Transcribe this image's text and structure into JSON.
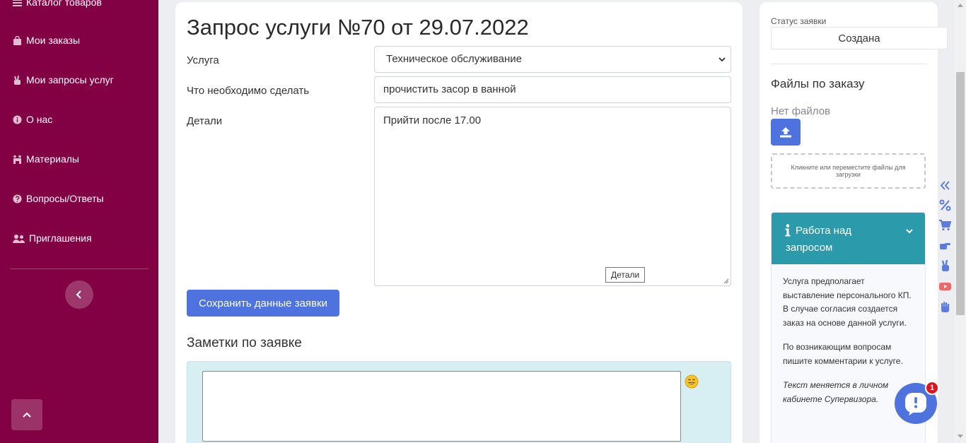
{
  "sidebar": {
    "items": [
      {
        "label": "Каталог товаров",
        "icon": "list-icon"
      },
      {
        "label": "Мои заказы",
        "icon": "shopping-bag-icon"
      },
      {
        "label": "Мои запросы услуг",
        "icon": "hand-peace-icon"
      },
      {
        "label": "О нас",
        "icon": "info-circle-icon"
      },
      {
        "label": "Материалы",
        "icon": "people-carry-icon"
      },
      {
        "label": "Вопросы/Ответы",
        "icon": "question-circle-icon"
      },
      {
        "label": "Приглашения",
        "icon": "user-friends-icon"
      }
    ],
    "collapse_icon": "chevron-left-icon",
    "scroll_top_icon": "chevron-up-icon"
  },
  "main": {
    "title": "Запрос услуги №70 от 29.07.2022",
    "service": {
      "label": "Услуга",
      "value": "Техническое обслуживание"
    },
    "todo": {
      "label": "Что необходимо сделать",
      "value": "прочистить засор в ванной"
    },
    "details": {
      "label": "Детали",
      "value": "Прийти после 17.00",
      "tooltip": "Детали"
    },
    "save_button": "Сохранить данные заявки",
    "notes_title": "Заметки по заявке"
  },
  "right": {
    "status_label": "Статус заявки",
    "status_value": "Создана",
    "files_title": "Файлы по заказу",
    "no_files": "Нет файлов",
    "dropzone_text": "Кликните или переместите файлы для загрузки",
    "info": {
      "title": "Работа над запросом",
      "paragraphs": [
        "Услуга предполагает выставление персонального КП. В случае согласия создается заказ на основе данной услуги.",
        "По возникающим вопросам пишите комментарии к услуге."
      ],
      "note": "Текст меняется в личном кабинете Супервизора."
    }
  },
  "chat": {
    "badge": "1"
  },
  "colors": {
    "sidebar": "#820044",
    "primary": "#4e73df",
    "info_header": "#2b9aaa",
    "notes_bg": "#d7eef3"
  }
}
